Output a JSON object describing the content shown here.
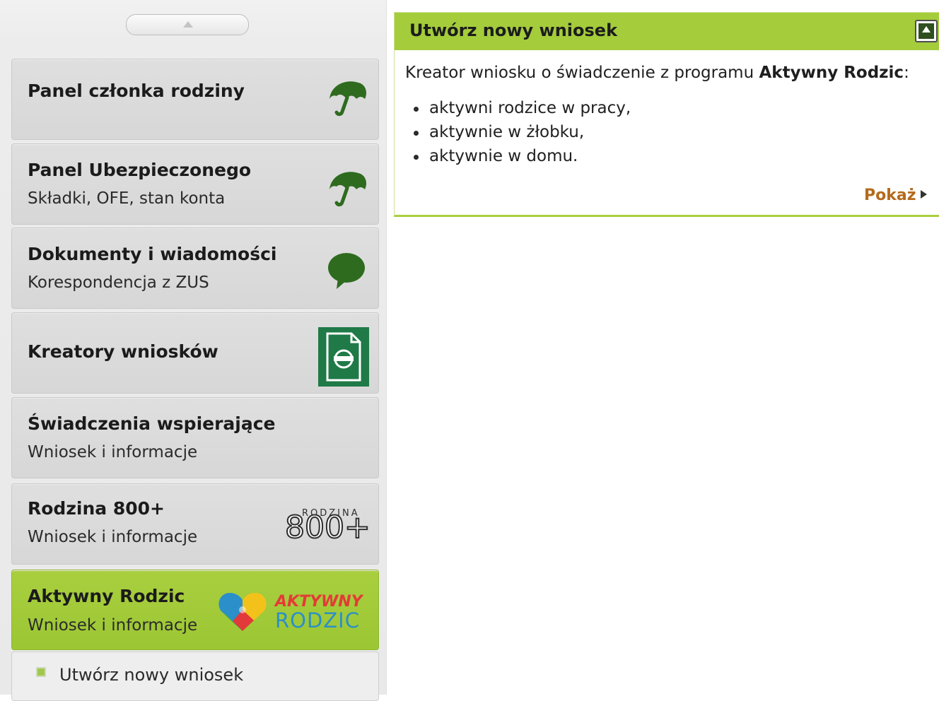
{
  "sidebar": {
    "tiles": [
      {
        "title": "Panel członka rodziny",
        "subtitle": "",
        "icon": "umbrella-icon"
      },
      {
        "title": "Panel Ubezpieczonego",
        "subtitle": "Składki, OFE, stan konta",
        "icon": "umbrella-icon"
      },
      {
        "title": "Dokumenty i wiadomości",
        "subtitle": "Korespondencja z ZUS",
        "icon": "speech-bubble-icon"
      },
      {
        "title": "Kreatory wniosków",
        "subtitle": "",
        "icon": "document-form-icon"
      },
      {
        "title": "Świadczenia wspierające",
        "subtitle": "Wniosek i informacje",
        "icon": ""
      },
      {
        "title": "Rodzina 800+",
        "subtitle": "Wniosek i informacje",
        "icon": "rodzina-800-logo"
      },
      {
        "title": "Aktywny Rodzic",
        "subtitle": "Wniosek i informacje",
        "icon": "aktywny-rodzic-logo",
        "active": true
      }
    ],
    "logos": {
      "rodzina_word": "RODZINA",
      "rodzina_number": "800+",
      "aktywny_line1": "AKTYWNY",
      "aktywny_line2": "RODZIC"
    },
    "subitem": {
      "label": "Utwórz nowy wniosek"
    }
  },
  "panel": {
    "title": "Utwórz nowy wniosek",
    "desc_prefix": "Kreator wniosku o świadczenie z programu ",
    "desc_bold": "Aktywny Rodzic",
    "desc_suffix": ":",
    "items": [
      "aktywni rodzice w pracy,",
      "aktywnie w żłobku,",
      "aktywnie w domu."
    ],
    "show_link": "Pokaż"
  },
  "colors": {
    "accent_green": "#a4cc3b",
    "icon_green": "#2e6b1f",
    "link_brown": "#b46a1b"
  }
}
